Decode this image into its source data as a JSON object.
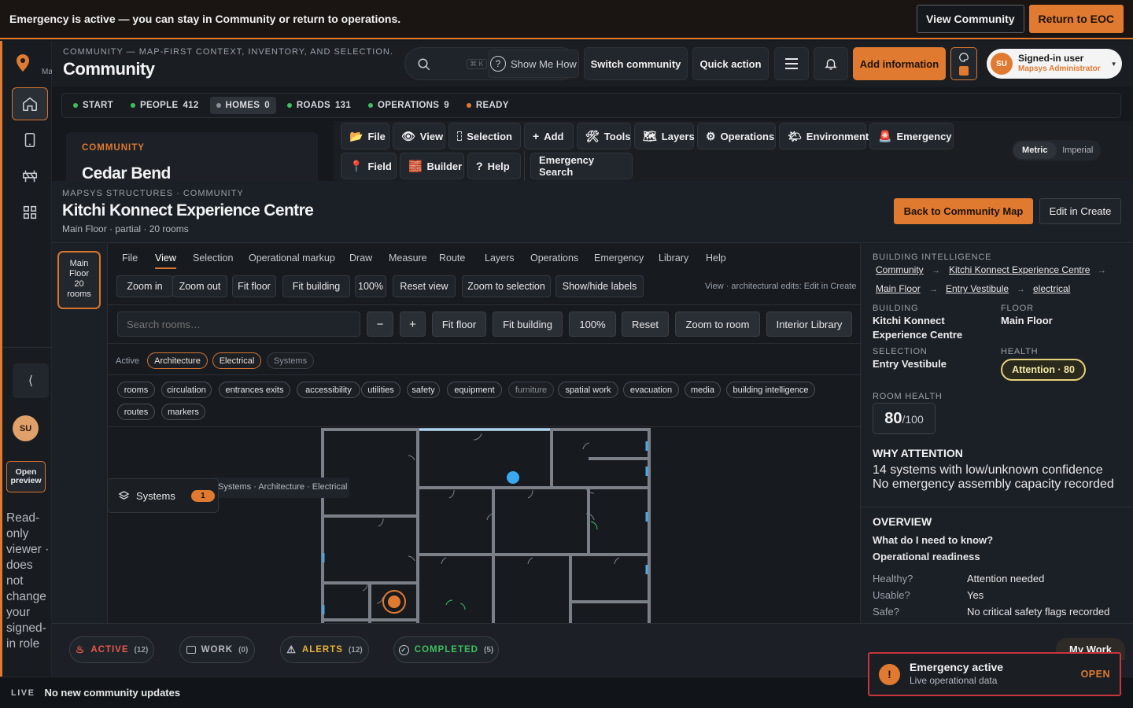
{
  "banner": {
    "message": "Emergency is active — you can stay in Community or return to operations.",
    "view_community": "View Community",
    "return_eoc": "Return to EOC"
  },
  "rail": {
    "map_label": "Ma",
    "collapse_glyph": "⟨",
    "avatar": "SU",
    "open_preview": "Open preview",
    "readonly_note": "Read-only viewer · does not change your signed-in role"
  },
  "header": {
    "subtitle": "COMMUNITY — MAP-FIRST CONTEXT, INVENTORY, AND SELECTION.",
    "title": "Community",
    "shortcut": "⌘ K",
    "show_me_how": "Show Me How",
    "switch_community": "Switch community",
    "quick_action": "Quick action",
    "add_information": "Add information",
    "user_initials": "SU",
    "user_name": "Signed-in user",
    "user_role": "Mapsys Administrator"
  },
  "status": [
    {
      "label": "START",
      "count": "",
      "color": "#3fbf5f",
      "selected": false
    },
    {
      "label": "PEOPLE",
      "count": "412",
      "color": "#3fbf5f",
      "selected": false
    },
    {
      "label": "HOMES",
      "count": "0",
      "color": "#8a9098",
      "selected": true
    },
    {
      "label": "ROADS",
      "count": "131",
      "color": "#3fbf5f",
      "selected": false
    },
    {
      "label": "OPERATIONS",
      "count": "9",
      "color": "#3fbf5f",
      "selected": false
    },
    {
      "label": "READY",
      "count": "",
      "color": "#e07a30",
      "selected": false
    }
  ],
  "toolbar": {
    "file": "File",
    "view": "View",
    "selection": "Selection",
    "add": "Add",
    "tools": "Tools",
    "layers": "Layers",
    "operations": "Operations",
    "environment": "Environment",
    "emergency": "Emergency",
    "field": "Field",
    "builder": "Builder",
    "help": "Help",
    "emergency_search": "Emergency Search",
    "metric": "Metric",
    "imperial": "Imperial"
  },
  "community_card": {
    "kicker": "COMMUNITY",
    "name": "Cedar Bend"
  },
  "structure": {
    "breadcrumb": "MAPSYS STRUCTURES · COMMUNITY",
    "title": "Kitchi Konnect Experience Centre",
    "meta": "Main Floor · partial · 20 rooms",
    "back": "Back to Community Map",
    "edit": "Edit in Create"
  },
  "floor_tile": {
    "name": "Main Floor",
    "count": "20",
    "unit": "rooms"
  },
  "center": {
    "menus": [
      "File",
      "View",
      "Selection",
      "Operational markup",
      "Draw",
      "Measure",
      "Route",
      "Layers",
      "Operations",
      "Emergency",
      "Library",
      "Help"
    ],
    "view_buttons": [
      "Zoom in",
      "Zoom out",
      "Fit floor",
      "Fit building",
      "100%",
      "Reset view",
      "Zoom to selection",
      "Show/hide labels"
    ],
    "view_note": "View · architectural edits: Edit in Create",
    "search_placeholder": "Search rooms…",
    "minus": "−",
    "plus": "+",
    "tools": [
      "Fit floor",
      "Fit building",
      "100%",
      "Reset",
      "Zoom to room",
      "Interior Library"
    ],
    "active_label": "Active",
    "active_layers": [
      {
        "label": "Architecture",
        "on": true
      },
      {
        "label": "Electrical",
        "on": true
      },
      {
        "label": "Systems",
        "on": false
      }
    ],
    "chips_row1": [
      "rooms",
      "circulation",
      "entrances exits",
      "accessibility",
      "utilities",
      "safety",
      "equipment",
      "furniture",
      "spatial work",
      "evacuation",
      "media",
      "building intelligence"
    ],
    "chips_row2": [
      "routes",
      "markers"
    ],
    "systems_label": "Systems",
    "systems_count": "1",
    "layer_note": "Systems · Architecture · Electrical"
  },
  "right": {
    "kicker": "BUILDING INTELLIGENCE",
    "crumbs": [
      "Community",
      "Kitchi Konnect Experience Centre",
      "Main Floor",
      "Entry Vestibule",
      "electrical"
    ],
    "arrow": "→",
    "building_label": "BUILDING",
    "building_value": "Kitchi Konnect Experience Centre",
    "floor_label": "FLOOR",
    "floor_value": "Main Floor",
    "selection_label": "SELECTION",
    "selection_value": "Entry Vestibule",
    "health_label": "HEALTH",
    "health_badge": "Attention · 80",
    "room_health_label": "ROOM HEALTH",
    "room_health_value": "80",
    "room_health_max": "/100",
    "why_title": "WHY ATTENTION",
    "why_items": [
      "14 systems with low/unknown confidence",
      "No emergency assembly capacity recorded"
    ],
    "overview_title": "OVERVIEW",
    "q1": "What do I need to know?",
    "q2": "Operational readiness",
    "rows": [
      {
        "k": "Healthy?",
        "v": "Attention needed"
      },
      {
        "k": "Usable?",
        "v": "Yes"
      },
      {
        "k": "Safe?",
        "v": "No critical safety flags recorded"
      }
    ]
  },
  "tray": {
    "active": "ACTIVE",
    "active_count": "(12)",
    "work": "WORK",
    "work_count": "(0)",
    "alerts": "ALERTS",
    "alerts_count": "(12)",
    "completed": "COMPLETED",
    "completed_count": "(5)",
    "my_work": "My Work"
  },
  "live": {
    "tag": "LIVE",
    "message": "No new community updates"
  },
  "toast": {
    "title": "Emergency active",
    "subtitle": "Live operational data",
    "open": "OPEN",
    "icon": "!"
  },
  "colors": {
    "accent": "#e07a30",
    "bg": "#15191e",
    "alert_red": "#c8343e",
    "health_yellow": "#e8d27a"
  }
}
